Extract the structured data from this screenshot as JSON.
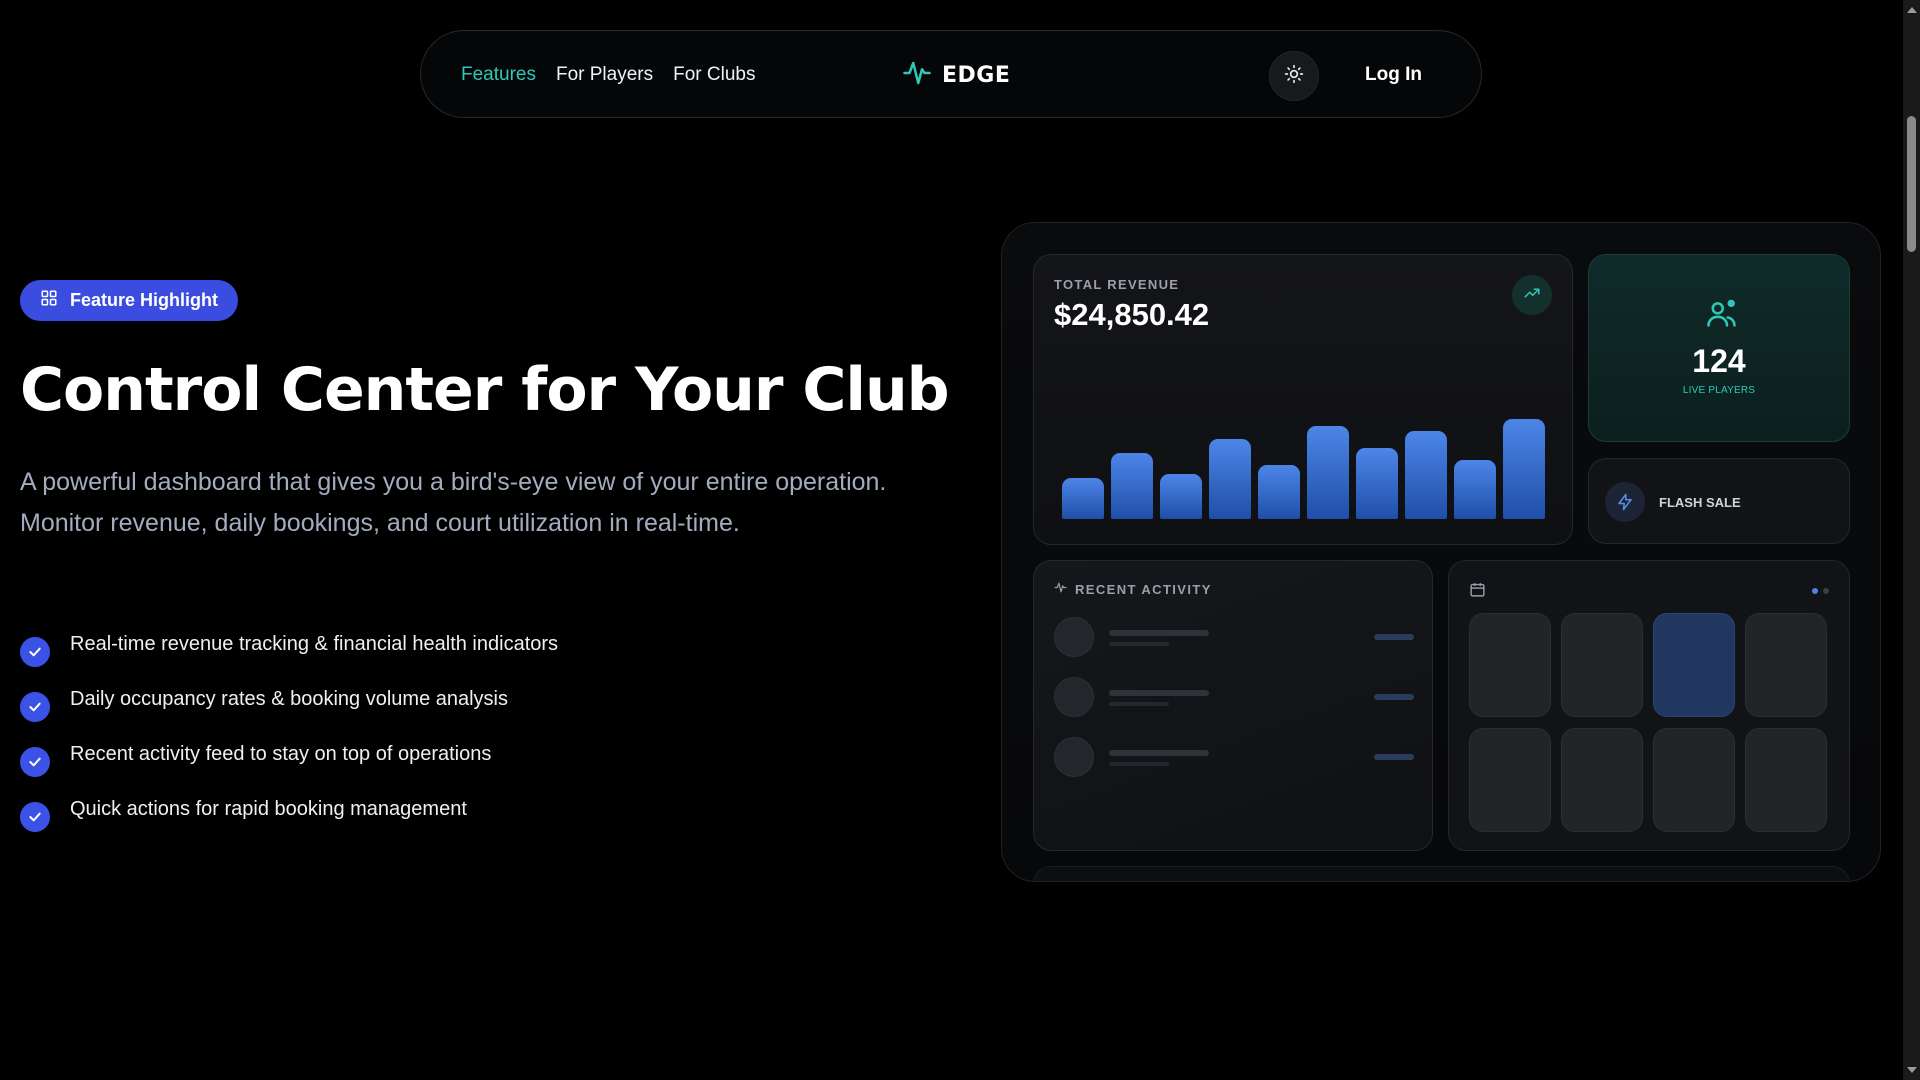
{
  "nav": {
    "links": [
      "Features",
      "For Players",
      "For Clubs"
    ],
    "active_link": "Features",
    "brand": "EDGE",
    "brand_icon": "pulse-icon",
    "theme_toggle_icon": "sun-icon",
    "login_label": "Log In"
  },
  "hero": {
    "badge": "Feature Highlight",
    "badge_icon": "grid-icon",
    "title": "Control Center for Your Club",
    "description": "A powerful dashboard that gives you a bird's-eye view of your entire operation. Monitor revenue, daily bookings, and court utilization in real-time.",
    "features": [
      "Real-time revenue tracking & financial health indicators",
      "Daily occupancy rates & booking volume analysis",
      "Recent activity feed to stay on top of operations",
      "Quick actions for rapid booking management"
    ]
  },
  "dashboard": {
    "revenue_label": "TOTAL REVENUE",
    "revenue_value": "$24,850.42",
    "revenue_bars": [
      0.39,
      0.63,
      0.43,
      0.77,
      0.52,
      0.89,
      0.68,
      0.85,
      0.57,
      0.96
    ],
    "players_count": "124",
    "players_label": "LIVE PLAYERS",
    "flash_label": "FLASH SALE",
    "activity_label": "RECENT ACTIVITY",
    "activity_rows": 3,
    "calendar_slots": 8,
    "calendar_selected_slot": 2
  },
  "colors": {
    "accent_teal": "#2fc8b7",
    "accent_blue": "#3b4de0",
    "bar_blue": "#4d86e8",
    "background": "#000000"
  }
}
